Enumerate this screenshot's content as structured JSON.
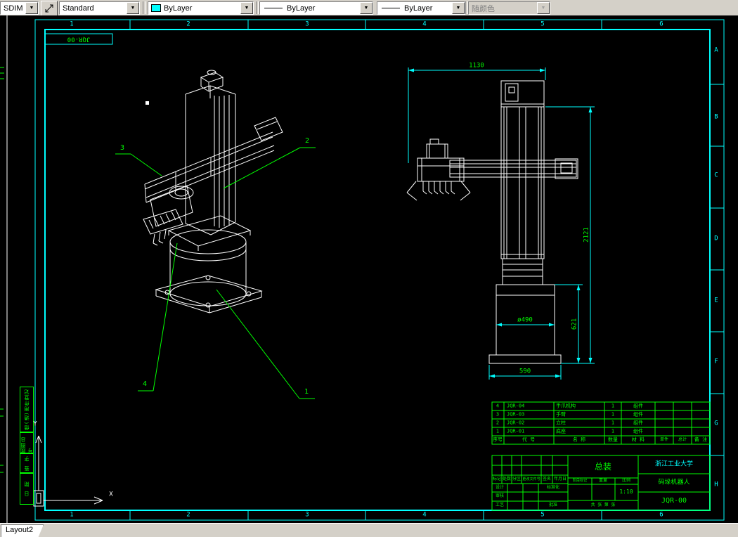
{
  "toolbar": {
    "dim_style": "SDIM",
    "text_style": "Standard",
    "color": "ByLayer",
    "linetype": "ByLayer",
    "lineweight": "ByLayer",
    "plot_style": "随颜色"
  },
  "frame": {
    "stamp": "JQR-00",
    "zone_numbers": [
      "1",
      "2",
      "3",
      "4",
      "5",
      "6"
    ],
    "zone_letters": [
      "A",
      "B",
      "C",
      "D",
      "E",
      "F",
      "G",
      "H"
    ]
  },
  "margin": {
    "labels": [
      "借(通)用件登记",
      "底图总号",
      "签 字",
      "日 期"
    ]
  },
  "ucs": {
    "x": "X",
    "y": "Y"
  },
  "balloons": [
    "1",
    "2",
    "3",
    "4"
  ],
  "dims": {
    "top_width": "1130",
    "overall_height": "2121",
    "base_height": "621",
    "base_dia": "ø490",
    "base_width": "590"
  },
  "bom": {
    "headers": [
      "序号",
      "代  号",
      "名  称",
      "数量",
      "材  料",
      "单件",
      "总计",
      "备 注"
    ],
    "rows": [
      {
        "no": "4",
        "code": "JQR-04",
        "name": "手爪机构",
        "qty": "1",
        "mat": "组件"
      },
      {
        "no": "3",
        "code": "JQR-03",
        "name": "手臂",
        "qty": "1",
        "mat": "组件"
      },
      {
        "no": "2",
        "code": "JQR-02",
        "name": "立柱",
        "qty": "1",
        "mat": "组件"
      },
      {
        "no": "1",
        "code": "JQR-01",
        "name": "底座",
        "qty": "1",
        "mat": "组件"
      }
    ]
  },
  "titleblock": {
    "org": "浙江工业大学",
    "title": "总装",
    "product": "码垛机器人",
    "drawing_no": "JQR-00",
    "scale_value": "1:10",
    "labels": {
      "mark": "标记",
      "count": "处数",
      "zone": "分区",
      "change_doc": "更改文件号",
      "sign": "签名",
      "date": "年月日",
      "design": "设计",
      "check": "审核",
      "process": "工艺",
      "standardize": "标准化",
      "approve": "批准",
      "stage": "阶段标记",
      "weight": "重量",
      "scale": "比例",
      "sheets": "共 张 第 张"
    }
  },
  "statusbar": {
    "tab": "Layout2"
  }
}
